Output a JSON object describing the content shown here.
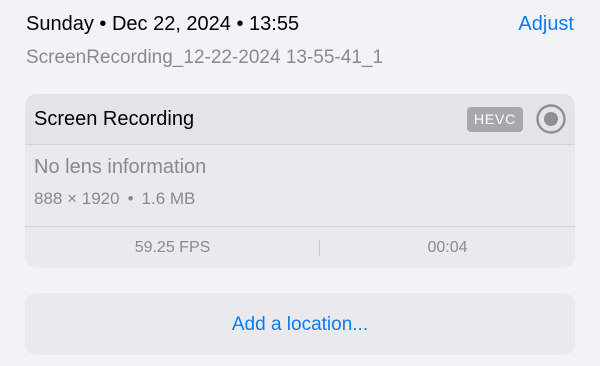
{
  "header": {
    "date_line": "Sunday • Dec 22, 2024 • 13:55",
    "adjust_label": "Adjust"
  },
  "file": {
    "name": "ScreenRecording_12-22-2024 13-55-41_1"
  },
  "info_card": {
    "title": "Screen Recording",
    "codec_badge": "HEVC",
    "record_icon": "record-circle-icon",
    "lens_info": "No lens information",
    "dimensions": "888 × 1920",
    "separator": "•",
    "size": "1.6 MB",
    "fps": "59.25 FPS",
    "duration": "00:04"
  },
  "location": {
    "label": "Add a location..."
  },
  "colors": {
    "accent": "#0a7cf2",
    "background": "#f2f2f7",
    "card": "#e9e9ee",
    "secondary_text": "#8a8a8e",
    "badge": "#a8a8ac"
  }
}
